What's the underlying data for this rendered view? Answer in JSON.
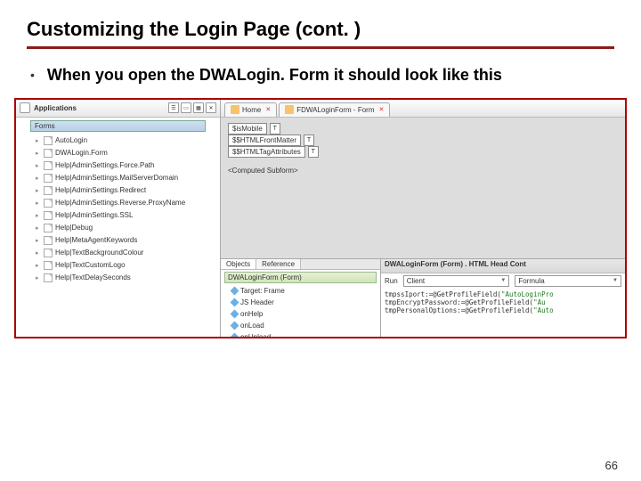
{
  "slide": {
    "title": "Customizing the Login Page (cont. )",
    "bullet": "When you open the DWALogin. Form it should look like this",
    "page_number": "66"
  },
  "panel": {
    "left": {
      "header": "Applications",
      "section": "Forms",
      "items": [
        "AutoLogin",
        "DWALogin.Form",
        "Help|AdminSettings.Force.Path",
        "Help|AdminSettings.MailServerDomain",
        "Help|AdminSettings.Redirect",
        "Help|AdminSettings.Reverse.ProxyName",
        "Help|AdminSettings.SSL",
        "Help|Debug",
        "Help|MetaAgentKeywords",
        "Help|TextBackgroundColour",
        "Help|TextCustomLogo",
        "Help|TextDelaySeconds"
      ]
    },
    "tabs": {
      "home": "Home",
      "form": "FDWALoginForm - Form"
    },
    "fields": [
      "$isMobile",
      "$$HTMLFrontMatter",
      "$$HTMLTagAttributes"
    ],
    "subform": "<Computed Subform>",
    "objects": {
      "tabs": [
        "Objects",
        "Reference"
      ],
      "header": "DWALoginForm (Form)",
      "items": [
        "Target: Frame",
        "JS Header",
        "onHelp",
        "onLoad",
        "onUnload"
      ]
    },
    "code": {
      "title": "DWALoginForm (Form) . HTML Head Cont",
      "run_label": "Run",
      "run_value": "Client",
      "type_value": "Formula",
      "lines": [
        "tmpssIport:=@GetProfileField(\"AutoLoginPro",
        "tmpEncryptPassword:=@GetProfileField(\"Au",
        "tmpPersonalOptions:=@GetProfileField(\"Auto"
      ]
    }
  }
}
